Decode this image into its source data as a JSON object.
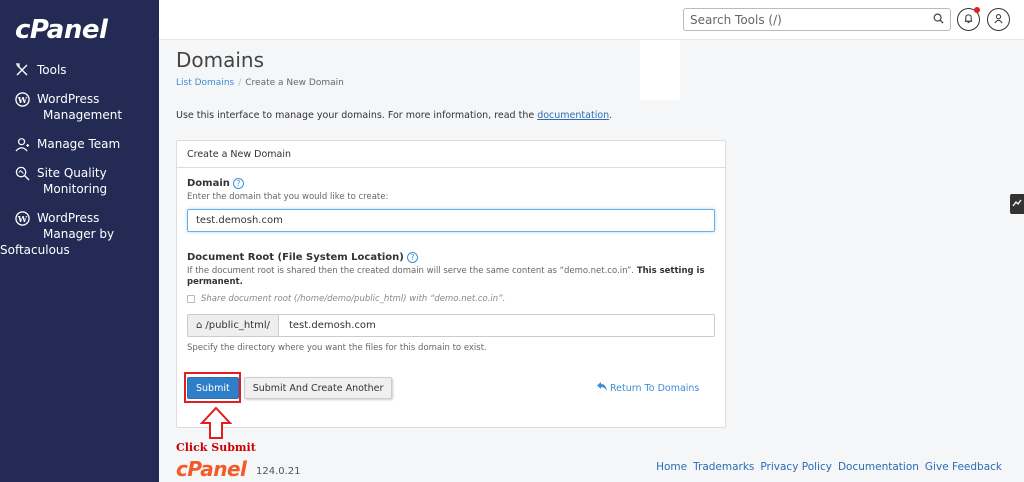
{
  "sidebar": {
    "logo": "cPanel",
    "items": [
      {
        "label": "Tools",
        "icon": "tools-icon"
      },
      {
        "label": "WordPress",
        "label2": "Management",
        "icon": "wordpress-icon"
      },
      {
        "label": "Manage Team",
        "icon": "team-icon"
      },
      {
        "label": "Site Quality",
        "label2": "Monitoring",
        "icon": "search-quality-icon"
      },
      {
        "label": "WordPress",
        "label2": "Manager by",
        "label3": "Softaculous",
        "icon": "wordpress-icon"
      }
    ]
  },
  "header": {
    "search_placeholder": "Search Tools (/)"
  },
  "main": {
    "title": "Domains",
    "breadcrumb": {
      "parent": "List Domains",
      "sep": "/",
      "current": "Create a New Domain"
    },
    "intro_text": "Use this interface to manage your domains. For more information, read the ",
    "intro_link": "documentation",
    "intro_end": "."
  },
  "form": {
    "panel_title": "Create a New Domain",
    "domain_label": "Domain",
    "domain_hint": "Enter the domain that you would like to create:",
    "domain_value": "test.demosh.com",
    "docroot_label": "Document Root (File System Location)",
    "docroot_hint": "If the document root is shared then the created domain will serve the same content as “demo.net.co.in”. ",
    "docroot_hint_bold": "This setting is permanent.",
    "share_label": "Share document root (/home/demo/public_html) with “demo.net.co.in”.",
    "path_prefix": "/public_html/",
    "path_value": "test.demosh.com",
    "path_hint": "Specify the directory where you want the files for this domain to exist.",
    "submit_label": "Submit",
    "submit_another_label": "Submit And Create Another",
    "return_label": "Return To Domains"
  },
  "annotation": {
    "text": "Click Submit",
    "color": "#e02020"
  },
  "footer": {
    "logo": "cPanel",
    "version": "124.0.21",
    "links": [
      "Home",
      "Trademarks",
      "Privacy Policy",
      "Documentation",
      "Give Feedback"
    ]
  },
  "colors": {
    "sidebar": "#232b55",
    "accent": "#2f7ec8",
    "brand_orange": "#f25a29"
  }
}
